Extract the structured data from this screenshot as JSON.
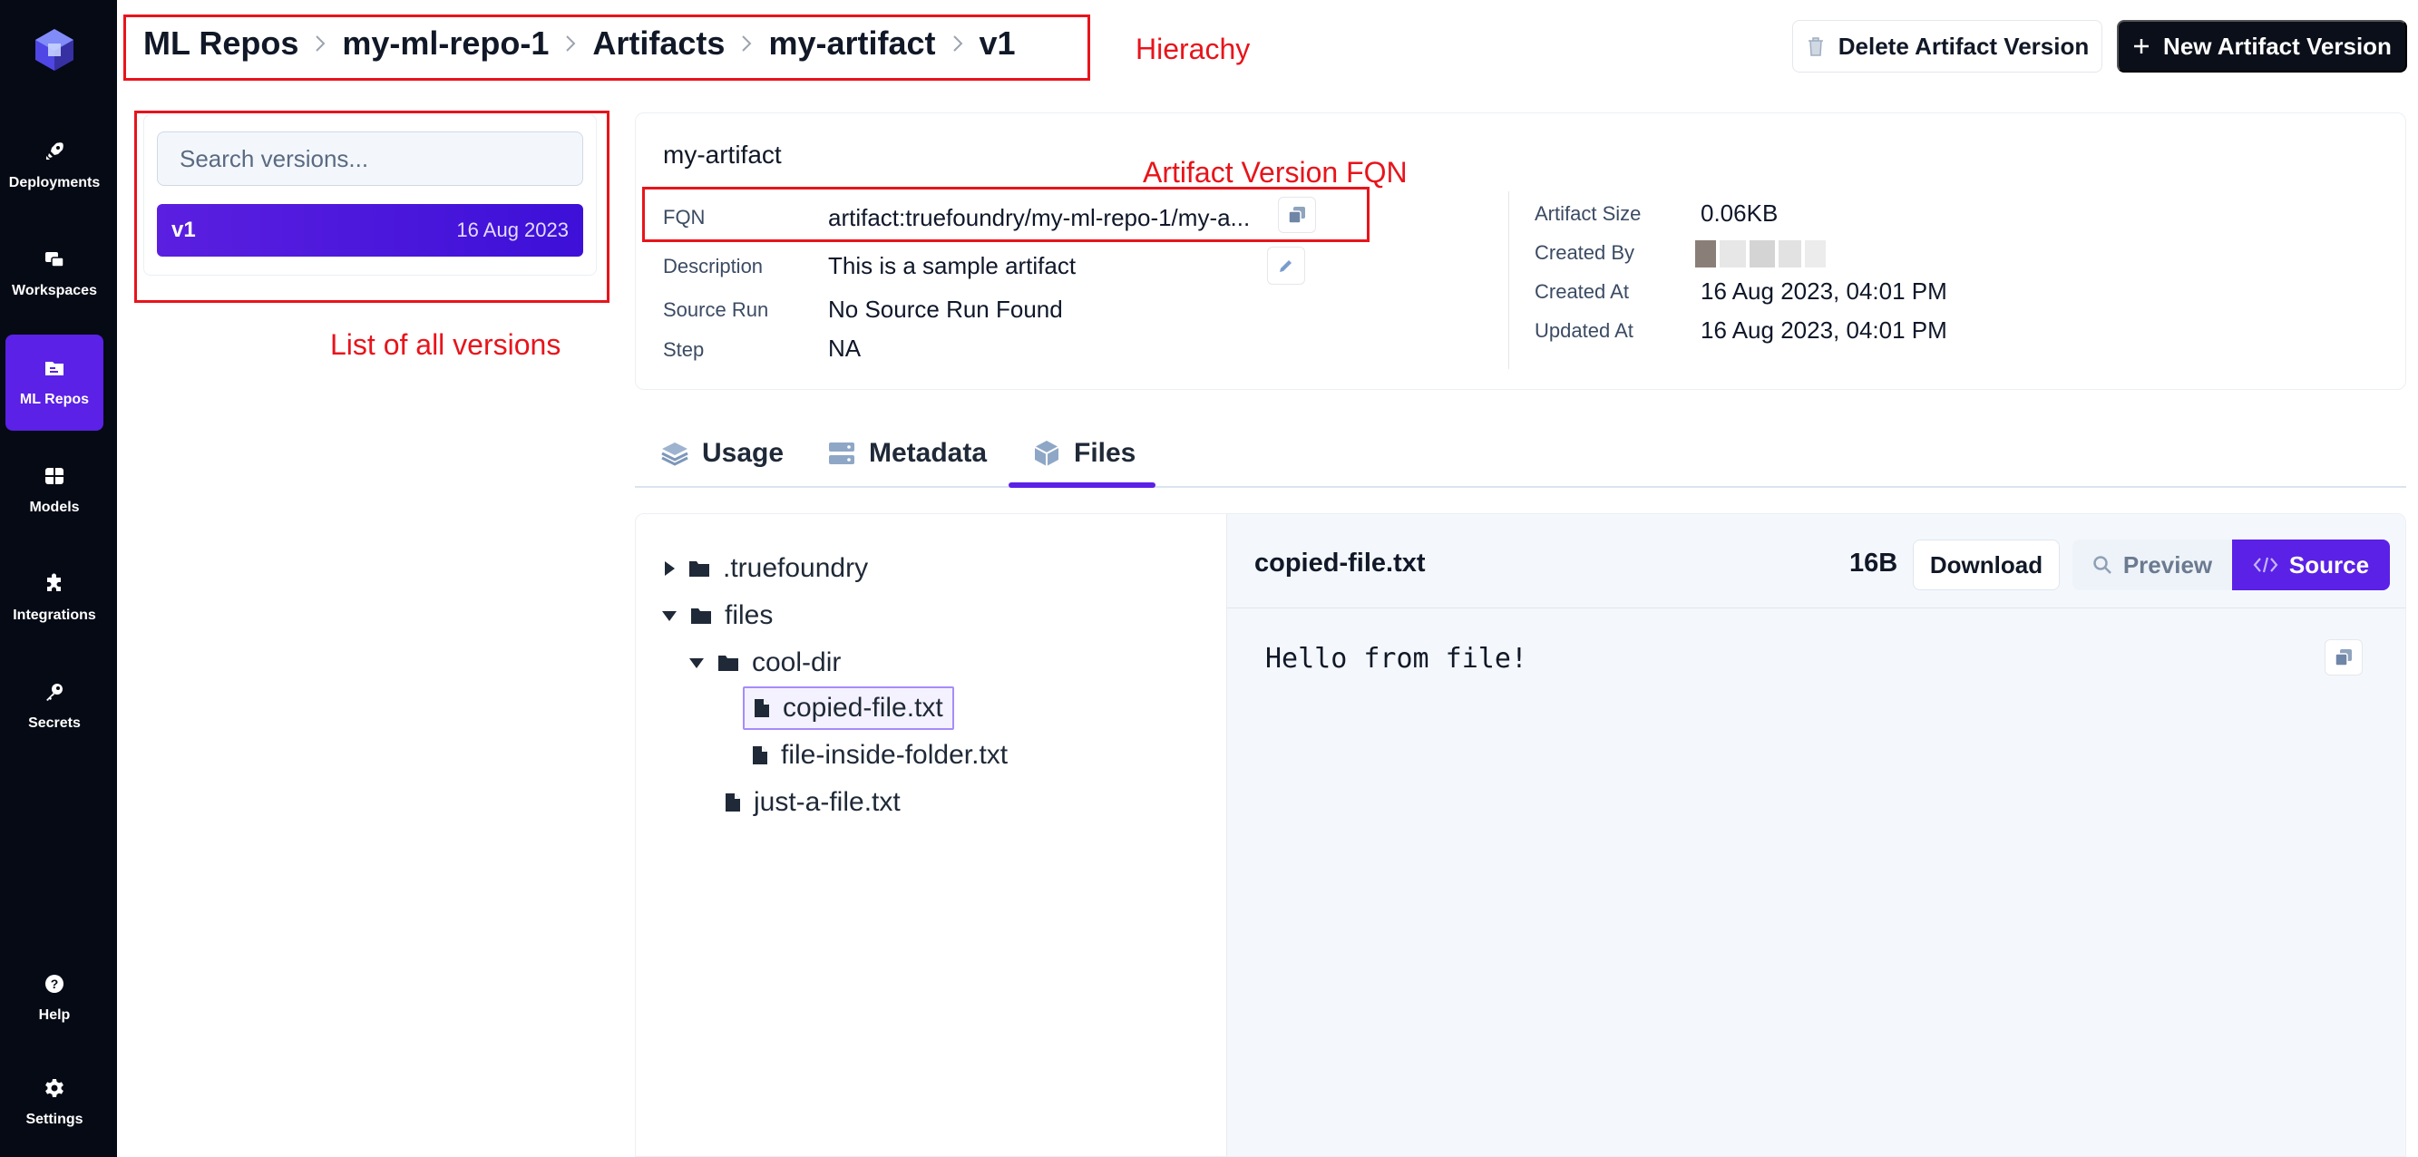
{
  "sidebar": {
    "items": [
      {
        "label": "Deployments",
        "icon": "rocket-icon"
      },
      {
        "label": "Workspaces",
        "icon": "workspace-icon"
      },
      {
        "label": "ML Repos",
        "icon": "folder-icon",
        "active": true
      },
      {
        "label": "Models",
        "icon": "grid-icon"
      },
      {
        "label": "Integrations",
        "icon": "puzzle-icon"
      },
      {
        "label": "Secrets",
        "icon": "key-icon"
      }
    ],
    "bottom": [
      {
        "label": "Help",
        "icon": "help-icon"
      },
      {
        "label": "Settings",
        "icon": "gear-icon"
      }
    ]
  },
  "breadcrumb": [
    "ML Repos",
    "my-ml-repo-1",
    "Artifacts",
    "my-artifact",
    "v1"
  ],
  "header": {
    "delete_label": "Delete Artifact Version",
    "new_label": "New Artifact Version"
  },
  "versions": {
    "search_placeholder": "Search versions...",
    "items": [
      {
        "name": "v1",
        "date": "16 Aug 2023"
      }
    ]
  },
  "details": {
    "artifact_name": "my-artifact",
    "fqn_label": "FQN",
    "fqn_value": "artifact:truefoundry/my-ml-repo-1/my-a...",
    "description_label": "Description",
    "description_value": "This is a sample artifact",
    "source_run_label": "Source Run",
    "source_run_value": "No Source Run Found",
    "step_label": "Step",
    "step_value": "NA",
    "size_label": "Artifact Size",
    "size_value": "0.06KB",
    "created_by_label": "Created By",
    "created_at_label": "Created At",
    "created_at_value": "16 Aug 2023, 04:01 PM",
    "updated_at_label": "Updated At",
    "updated_at_value": "16 Aug 2023, 04:01 PM"
  },
  "tabs": [
    {
      "label": "Usage",
      "icon": "layers-icon"
    },
    {
      "label": "Metadata",
      "icon": "server-icon"
    },
    {
      "label": "Files",
      "icon": "box-icon",
      "active": true
    }
  ],
  "file_tree": [
    {
      "name": ".truefoundry",
      "type": "folder",
      "expanded": false
    },
    {
      "name": "files",
      "type": "folder",
      "expanded": true
    },
    {
      "name": "cool-dir",
      "type": "folder",
      "expanded": true
    },
    {
      "name": "copied-file.txt",
      "type": "file",
      "selected": true
    },
    {
      "name": "file-inside-folder.txt",
      "type": "file"
    },
    {
      "name": "just-a-file.txt",
      "type": "file"
    }
  ],
  "preview": {
    "filename": "copied-file.txt",
    "size": "16B",
    "download_label": "Download",
    "preview_label": "Preview",
    "source_label": "Source",
    "content": "Hello from file!"
  },
  "annotations": {
    "hierarchy": "Hierachy",
    "fqn": "Artifact Version FQN",
    "versions": "List of all versions"
  },
  "colors": {
    "accent": "#5b21e6",
    "sidebar_bg": "#060a15",
    "annotation": "#e8141b"
  }
}
